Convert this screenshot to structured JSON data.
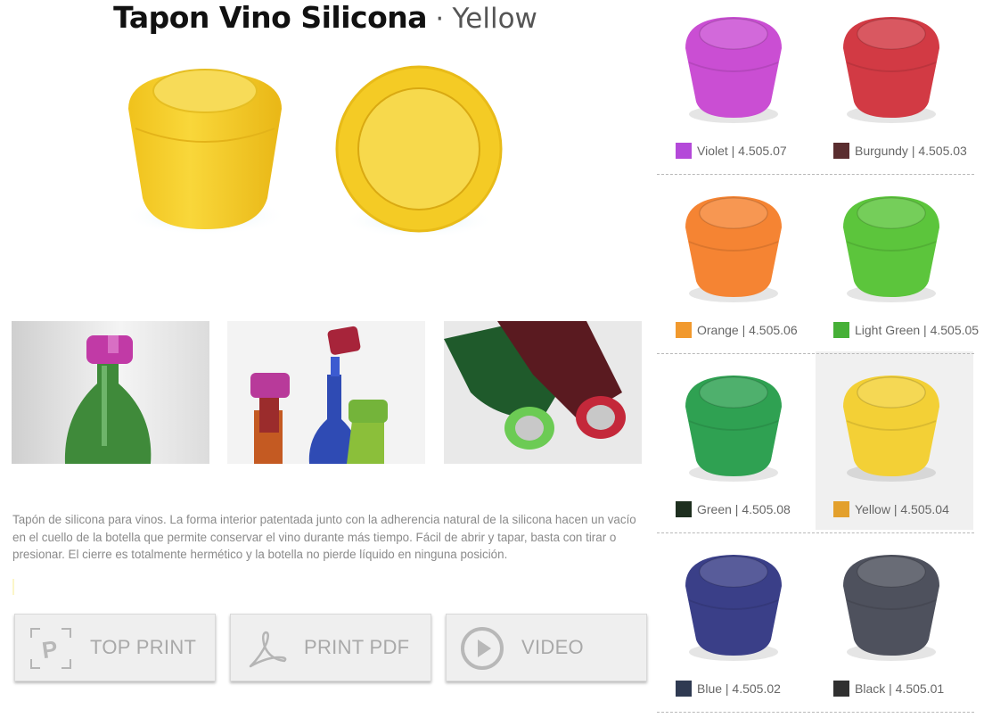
{
  "product": {
    "name": "Tapon Vino Silicona",
    "separator": "·",
    "variant": "Yellow",
    "description": "Tapón de silicona para vinos. La forma interior patentada junto con la adherencia natural de la silicona hacen un vacío en el cuello de la botella que permite conservar el vino durante más tiempo. Fácil de abrir y tapar, basta con tirar o presionar. El cierre es totalmente hermético y la botella no pierde líquido en ninguna posición."
  },
  "actions": {
    "top_print": "TOP PRINT",
    "print_pdf": "PRINT PDF",
    "video": "VIDEO"
  },
  "swatches": [
    {
      "label": "Violet | 4.505.07",
      "color": "#c63fd0",
      "chip": "#b449d9",
      "selected": false
    },
    {
      "label": "Burgundy | 4.505.03",
      "color": "#cf2a35",
      "chip": "#5a2d2f",
      "selected": false
    },
    {
      "label": "Orange | 4.505.06",
      "color": "#f57a22",
      "chip": "#f1992e",
      "selected": false
    },
    {
      "label": "Light Green | 4.505.05",
      "color": "#4fc12c",
      "chip": "#46b037",
      "selected": false
    },
    {
      "label": "Green | 4.505.08",
      "color": "#1e9a44",
      "chip": "#1e2f1f",
      "selected": false
    },
    {
      "label": "Yellow | 4.505.04",
      "color": "#f2cd25",
      "chip": "#e3a02c",
      "selected": true
    },
    {
      "label": "Blue | 4.505.02",
      "color": "#2a2f7e",
      "chip": "#2f3a52",
      "selected": false
    },
    {
      "label": "Black | 4.505.01",
      "color": "#3f4350",
      "chip": "#303030",
      "selected": false
    }
  ]
}
